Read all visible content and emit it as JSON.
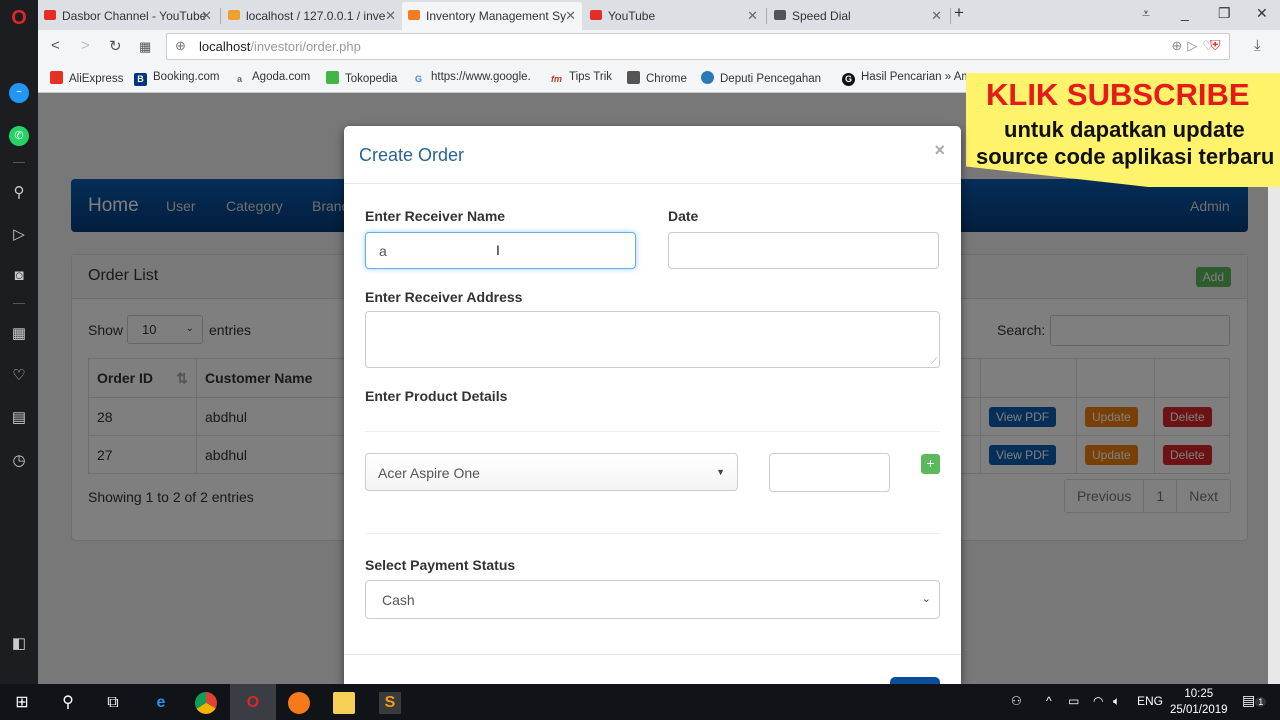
{
  "browser": {
    "tabs": [
      {
        "title": "Dasbor Channel - YouTube",
        "favicon": "youtube-icon",
        "color": "#e52d27"
      },
      {
        "title": "localhost / 127.0.0.1 / inve",
        "favicon": "phpmyadmin-icon",
        "color": "#f0a030"
      },
      {
        "title": "Inventory Management Sy",
        "favicon": "xampp-icon",
        "color": "#f37b20"
      },
      {
        "title": "YouTube",
        "favicon": "youtube-icon",
        "color": "#e52d27"
      },
      {
        "title": "Speed Dial",
        "favicon": "speed-dial-icon",
        "color": "#555555"
      }
    ],
    "url_host": "localhost",
    "url_path": "/investori/order.php",
    "bookmarks": [
      {
        "label": "AliExpress",
        "icon": "aliexpress-icon",
        "color": "#e43225"
      },
      {
        "label": "Booking.com",
        "icon": "booking-icon",
        "color": "#003580"
      },
      {
        "label": "Agoda.com",
        "icon": "agoda-icon",
        "color": "#666666"
      },
      {
        "label": "Tokopedia",
        "icon": "tokopedia-icon",
        "color": "#42b549"
      },
      {
        "label": "https://www.google.",
        "icon": "google-icon",
        "color": "#4285f4"
      },
      {
        "label": "Tips Trik",
        "icon": "fm-icon",
        "color": "#c0392b"
      },
      {
        "label": "Chrome",
        "icon": "file-icon",
        "color": "#555555"
      },
      {
        "label": "Deputi Pencegahan",
        "icon": "globe-icon",
        "color": "#2a7ab8"
      },
      {
        "label": "Hasil Pencarian » Am",
        "icon": "g-icon",
        "color": "#111111"
      }
    ]
  },
  "banner": {
    "line1": "KLIK SUBSCRIBE",
    "line2": "untuk dapatkan update",
    "line3": "source code aplikasi terbaru"
  },
  "app": {
    "brand": "Home",
    "nav": [
      "User",
      "Category",
      "Brand"
    ],
    "admin": "Admin",
    "panel_title": "Order List",
    "add_label": "Add",
    "show_label": "Show",
    "page_size": "10",
    "entries_label": "entries",
    "search_label": "Search:",
    "columns": [
      "Order ID",
      "Customer Name",
      "",
      "",
      ""
    ],
    "rows": [
      {
        "id": "28",
        "name": "abdhul",
        "pdf": "View PDF",
        "update": "Update",
        "delete": "Delete"
      },
      {
        "id": "27",
        "name": "abdhul",
        "pdf": "View PDF",
        "update": "Update",
        "delete": "Delete"
      }
    ],
    "info": "Showing 1 to 2 of 2 entries",
    "pager": [
      "Previous",
      "1",
      "Next"
    ]
  },
  "modal": {
    "title": "Create Order",
    "close": "×",
    "receiver_name_label": "Enter Receiver Name",
    "receiver_name_value": "a",
    "date_label": "Date",
    "date_value": "",
    "address_label": "Enter Receiver Address",
    "address_value": "",
    "product_label": "Enter Product Details",
    "product_selected": "Acer Aspire One",
    "quantity_value": "",
    "add_product": "+",
    "payment_label": "Select Payment Status",
    "payment_selected": "Cash"
  },
  "taskbar": {
    "lang": "ENG",
    "time": "10:25",
    "date": "25/01/2019",
    "notifications": "1"
  }
}
